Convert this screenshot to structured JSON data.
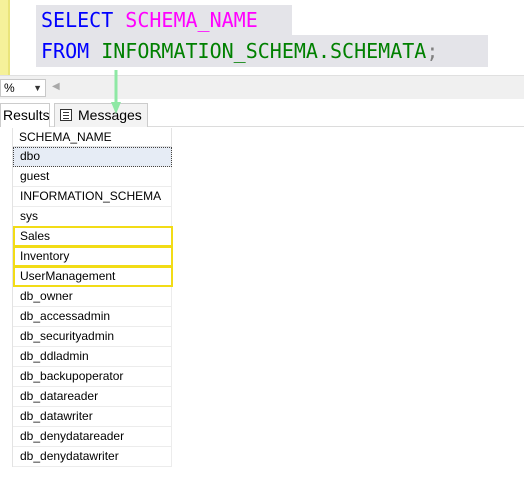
{
  "editor": {
    "line1": {
      "keyword": "SELECT",
      "column": "SCHEMA_NAME"
    },
    "line2": {
      "keyword": "FROM",
      "view": "INFORMATION_SCHEMA.SCHEMATA",
      "terminator": ";"
    }
  },
  "zoom": {
    "value": "%"
  },
  "tabs": {
    "results": "Results",
    "messages": "Messages"
  },
  "results": {
    "column_header": "SCHEMA_NAME",
    "rows": [
      "dbo",
      "guest",
      "INFORMATION_SCHEMA",
      "sys",
      "Sales",
      "Inventory",
      "UserManagement",
      "db_owner",
      "db_accessadmin",
      "db_securityadmin",
      "db_ddladmin",
      "db_backupoperator",
      "db_datareader",
      "db_datawriter",
      "db_denydatareader",
      "db_denydatawriter"
    ]
  },
  "colors": {
    "keyword": "#0000ff",
    "function": "#ff00ff",
    "system_view": "#008000",
    "highlight_box": "#f2dc16",
    "annotation_arrow": "#8ee8a4"
  }
}
